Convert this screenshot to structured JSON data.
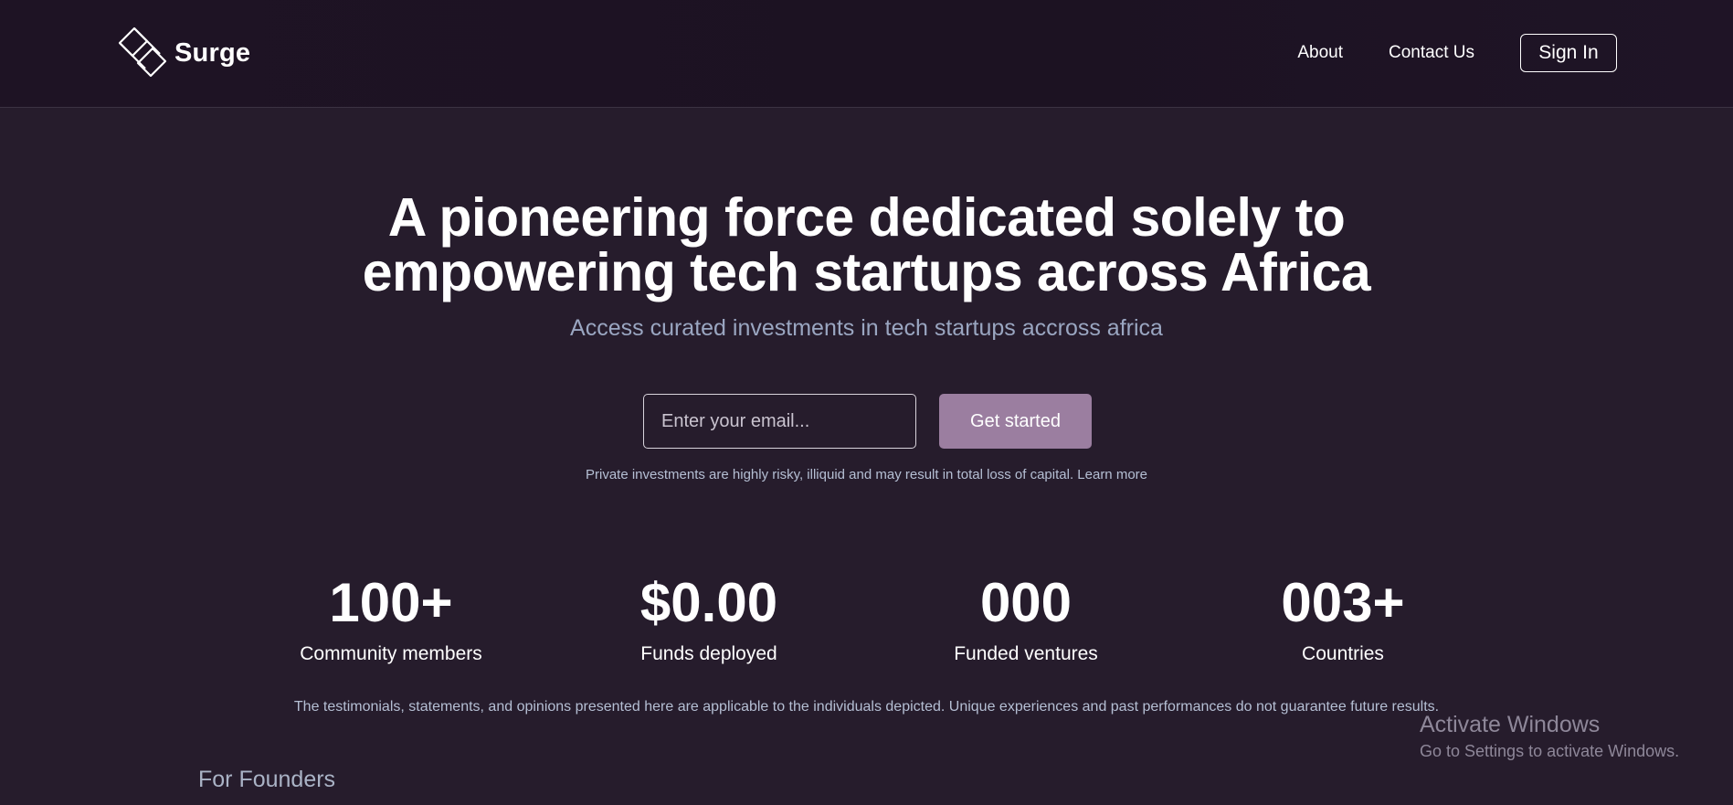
{
  "header": {
    "brand": "Surge",
    "nav": [
      {
        "label": "About"
      },
      {
        "label": "Contact Us"
      }
    ],
    "sign_in_label": "Sign In"
  },
  "hero": {
    "title_line1": "A pioneering force dedicated solely to",
    "title_line2": "empowering tech startups across Africa",
    "subtitle": "Access curated investments in tech startups accross africa",
    "email_placeholder": "Enter your email...",
    "cta_label": "Get started",
    "disclaimer": "Private investments are highly risky, illiquid and may result in total loss of capital. Learn more"
  },
  "stats": [
    {
      "value": "100+",
      "label": "Community members"
    },
    {
      "value": "$0.00",
      "label": "Funds deployed"
    },
    {
      "value": "000",
      "label": "Funded ventures"
    },
    {
      "value": "003+",
      "label": "Countries"
    }
  ],
  "testimonial_note": "The testimonials, statements, and opinions presented here are applicable to the individuals depicted. Unique experiences and past performances do not guarantee future results.",
  "section": {
    "heading": "For Founders"
  },
  "os_watermark": {
    "title": "Activate Windows",
    "subtitle": "Go to Settings to activate Windows."
  },
  "colors": {
    "background": "#261c2c",
    "navbar": "#1e1324",
    "accent_button": "#9b7ea0",
    "muted_text": "#9aa6c1"
  }
}
